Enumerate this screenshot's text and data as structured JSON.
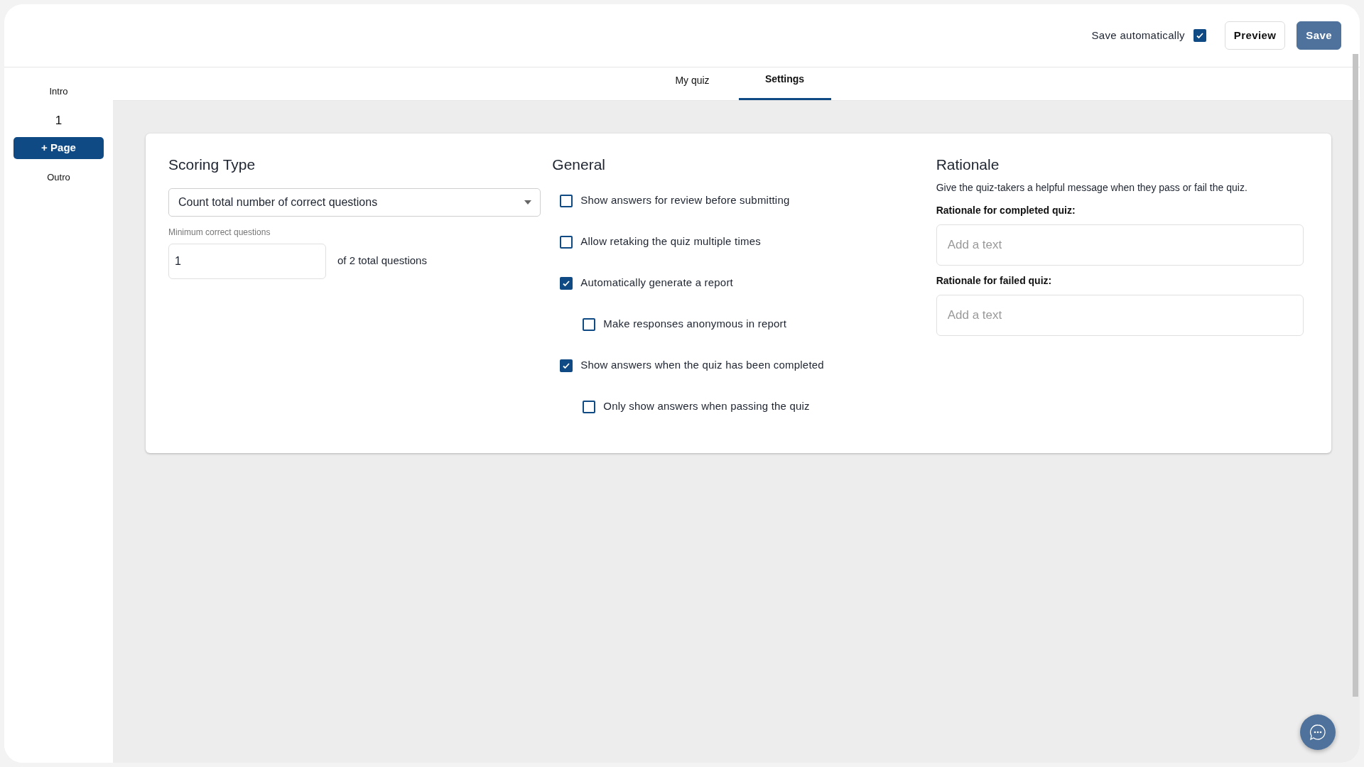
{
  "header": {
    "autosave": {
      "label": "Save automatically",
      "checked": true
    },
    "buttons": [
      {
        "label": "Preview",
        "kind": "secondary"
      },
      {
        "label": "Save",
        "kind": "primary"
      }
    ]
  },
  "tabs": [
    {
      "label": "My quiz",
      "selected": false
    },
    {
      "label": "Settings",
      "selected": true
    }
  ],
  "sidebar": {
    "items": [
      {
        "label": "Intro",
        "kind": "link"
      },
      {
        "label": "1",
        "kind": "page"
      },
      {
        "label": "+ Page",
        "kind": "button"
      },
      {
        "label": "Outro",
        "kind": "link"
      }
    ]
  },
  "scoring": {
    "title": "Scoring Type",
    "select": {
      "value": "Count total number of correct questions"
    },
    "minimum": {
      "label": "Minimum correct questions",
      "value": "1",
      "suffix": "of 2 total questions"
    }
  },
  "general": {
    "title": "General",
    "options": [
      {
        "label": "Show answers for review before submitting",
        "checked": false
      },
      {
        "label": "Allow retaking the quiz multiple times",
        "checked": false
      },
      {
        "label": "Automatically generate a report",
        "checked": true,
        "children": [
          {
            "label": "Make responses anonymous in report",
            "checked": false
          }
        ]
      },
      {
        "label": "Show answers when the quiz has been completed",
        "checked": true,
        "children": [
          {
            "label": "Only show answers when passing the quiz",
            "checked": false
          }
        ]
      }
    ]
  },
  "rationale": {
    "title": "Rationale",
    "description": "Give the quiz-takers a helpful message when they pass or fail the quiz.",
    "fields": [
      {
        "label": "Rationale for completed quiz:",
        "placeholder": "Add a text"
      },
      {
        "label": "Rationale for failed quiz:",
        "placeholder": "Add a text"
      }
    ]
  }
}
